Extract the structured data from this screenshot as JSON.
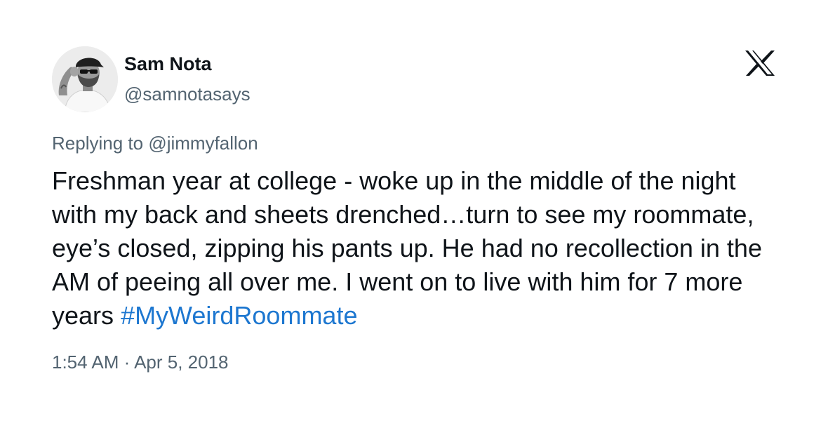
{
  "author": {
    "display_name": "Sam Nota",
    "handle": "@samnotasays",
    "avatar_icon": "user-avatar-photo"
  },
  "brand": {
    "logo_icon": "x-logo-icon"
  },
  "reply": {
    "prefix": "Replying to ",
    "to": "@jimmyfallon"
  },
  "tweet": {
    "text": "Freshman year at college - woke up in the middle of the night with my back and sheets drenched…turn to see my roommate, eye’s closed, zipping his pants up. He had no recollection in the AM of peeing all over me. I went on to live with him for 7 more years ",
    "hashtag": "#MyWeirdRoommate",
    "timestamp": "1:54 AM · Apr 5, 2018"
  },
  "colors": {
    "text": "#0f1419",
    "secondary": "#536471",
    "link": "#1d77d0"
  }
}
